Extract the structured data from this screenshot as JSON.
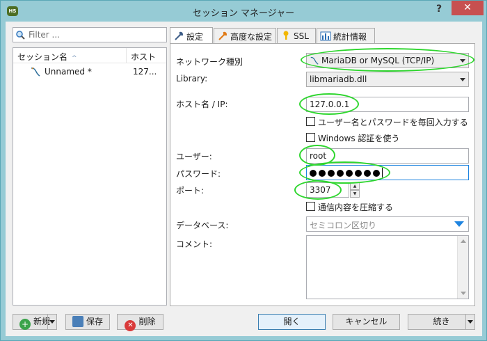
{
  "window": {
    "title": "セッション マネージャー",
    "help": "?",
    "close": "✕",
    "app_icon": "HS"
  },
  "filter": {
    "placeholder": "Filter ..."
  },
  "tree": {
    "columns": [
      "セッション名",
      "ホスト"
    ],
    "sort_indicator": "^",
    "rows": [
      {
        "name": "Unnamed *",
        "host": "127..."
      }
    ]
  },
  "tabs": [
    {
      "label": "設定",
      "icon": "wrench-icon"
    },
    {
      "label": "高度な設定",
      "icon": "wrench-orange-icon"
    },
    {
      "label": "SSL",
      "icon": "key-icon"
    },
    {
      "label": "統計情報",
      "icon": "bar-chart-icon"
    }
  ],
  "form": {
    "network_type": {
      "label": "ネットワーク種別",
      "value": "MariaDB or MySQL (TCP/IP)"
    },
    "library": {
      "label": "Library:",
      "value": "libmariadb.dll"
    },
    "host": {
      "label": "ホスト名 / IP:",
      "value": "127.0.0.1"
    },
    "prompt_credentials": {
      "label": "ユーザー名とパスワードを毎回入力する",
      "checked": false
    },
    "windows_auth": {
      "label": "Windows 認証を使う",
      "checked": false
    },
    "user": {
      "label": "ユーザー:",
      "value": "root"
    },
    "password": {
      "label": "パスワード:",
      "length": 8
    },
    "port": {
      "label": "ポート:",
      "value": "3307"
    },
    "compress": {
      "label": "通信内容を圧縮する",
      "checked": false
    },
    "databases": {
      "label": "データベース:",
      "placeholder": "セミコロン区切り"
    },
    "comment": {
      "label": "コメント:",
      "value": ""
    }
  },
  "buttons": {
    "new": "新規",
    "save": "保存",
    "delete": "削除",
    "open": "開く",
    "cancel": "キャンセル",
    "more": "続き"
  },
  "colors": {
    "title_bar": "#96cbd5",
    "close": "#c75050",
    "highlight": "#2fd62f",
    "focus_border": "#1e84e0"
  }
}
